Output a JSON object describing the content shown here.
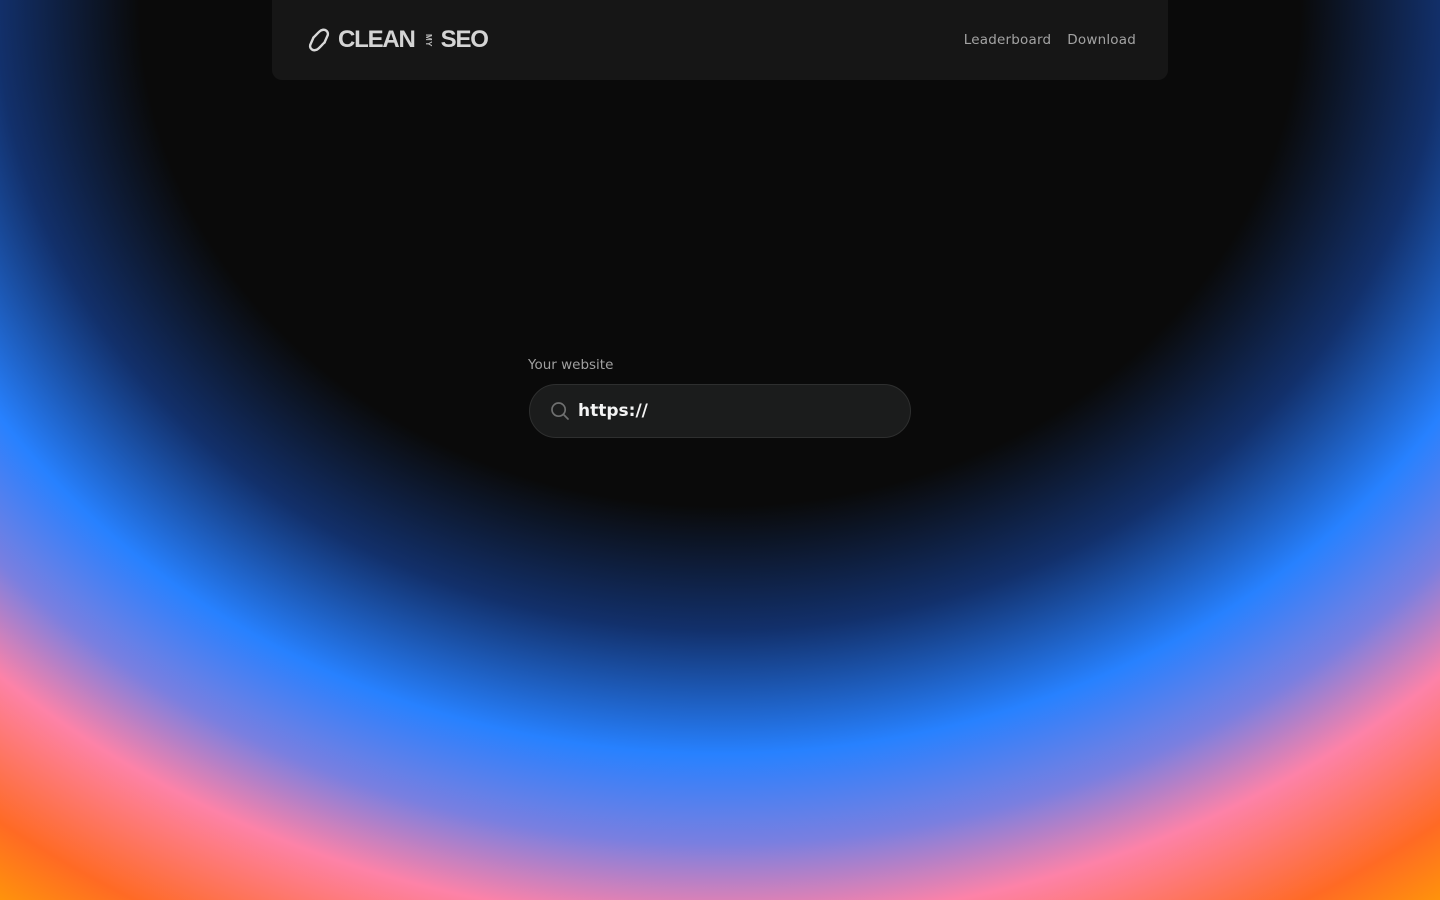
{
  "brand": {
    "word_left": "CLEAN",
    "word_mid": "MY",
    "word_right": "SEO"
  },
  "nav": {
    "items": [
      {
        "label": "Leaderboard"
      },
      {
        "label": "Download"
      }
    ]
  },
  "form": {
    "label": "Your website",
    "input_value": "https://",
    "search_icon": "search-icon"
  },
  "colors": {
    "navbar_bg": "#161616",
    "input_bg": "#1b1c1c",
    "gradient_blue": "#2781ff",
    "gradient_pink": "#fd82a8",
    "gradient_orange": "#ff6a24",
    "gradient_yellow": "#ffa500"
  }
}
